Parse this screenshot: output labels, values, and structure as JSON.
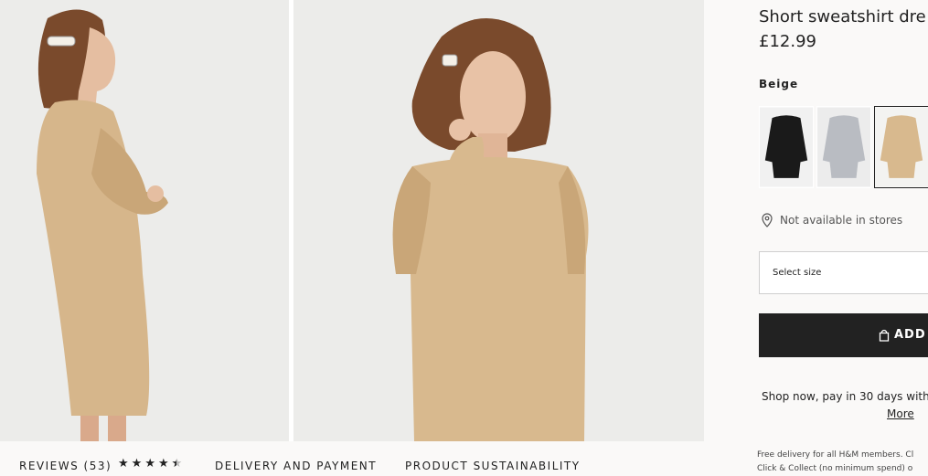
{
  "product": {
    "title": "Short sweatshirt dre",
    "price": "£12.99",
    "color_label": "Beige",
    "swatches": [
      {
        "name": "Black",
        "color": "#1a1a1a",
        "selected": false
      },
      {
        "name": "Grey",
        "color": "#b9bcc2",
        "selected": false
      },
      {
        "name": "Beige",
        "color": "#d8b98e",
        "selected": true
      }
    ],
    "store_availability": "Not available in stores",
    "size_placeholder": "Select size",
    "add_button": "ADD",
    "pay_later": "Shop now, pay in 30 days with",
    "more_link": "More",
    "delivery_note_1": "Free delivery for all H&M members. Cl",
    "delivery_note_2": "Click & Collect (no minimum spend) o"
  },
  "tabs": {
    "reviews": "REVIEWS (53)",
    "rating": 4.5,
    "delivery": "DELIVERY AND PAYMENT",
    "sustainability": "PRODUCT SUSTAINABILITY"
  },
  "colors": {
    "dress": "#d8b98e",
    "dress_shadow": "#c6a376",
    "hair": "#7a4a2c",
    "skin": "#e8c2a6",
    "photo_bg": "#ededed",
    "button_bg": "#222222"
  }
}
